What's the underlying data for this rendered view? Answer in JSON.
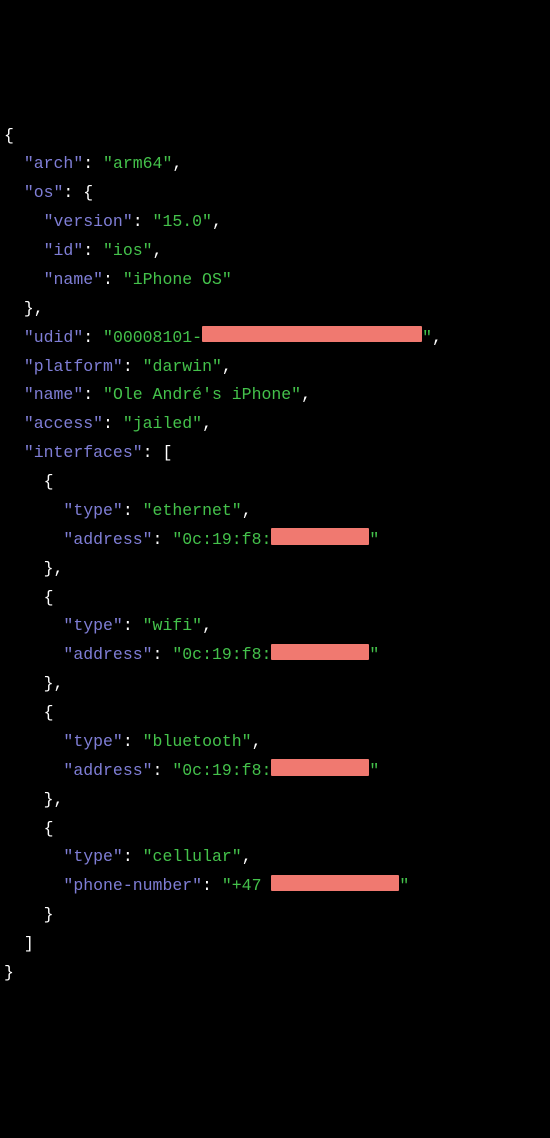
{
  "k_arch": "\"arch\"",
  "v_arch": "\"arm64\"",
  "k_os": "\"os\"",
  "k_os_version": "\"version\"",
  "v_os_version": "\"15.0\"",
  "k_os_id": "\"id\"",
  "v_os_id": "\"ios\"",
  "k_os_name": "\"name\"",
  "v_os_name": "\"iPhone OS\"",
  "k_udid": "\"udid\"",
  "v_udid_pre": "\"00008101-",
  "v_udid_post": "\"",
  "k_platform": "\"platform\"",
  "v_platform": "\"darwin\"",
  "k_name": "\"name\"",
  "v_name": "\"Ole André's iPhone\"",
  "k_access": "\"access\"",
  "v_access": "\"jailed\"",
  "k_interfaces": "\"interfaces\"",
  "k_type": "\"type\"",
  "k_address": "\"address\"",
  "k_phone": "\"phone-number\"",
  "v_type_eth": "\"ethernet\"",
  "v_type_wifi": "\"wifi\"",
  "v_type_bt": "\"bluetooth\"",
  "v_type_cell": "\"cellular\"",
  "v_addr_pre": "\"0c:19:f8:",
  "v_addr_post": "\"",
  "v_phone_pre": "\"+47 ",
  "v_phone_post": "\"",
  "p_obrace": "{",
  "p_cbrace": "}",
  "p_obrack": "[",
  "p_cbrack": "]",
  "p_colon": ": ",
  "p_comma": ","
}
